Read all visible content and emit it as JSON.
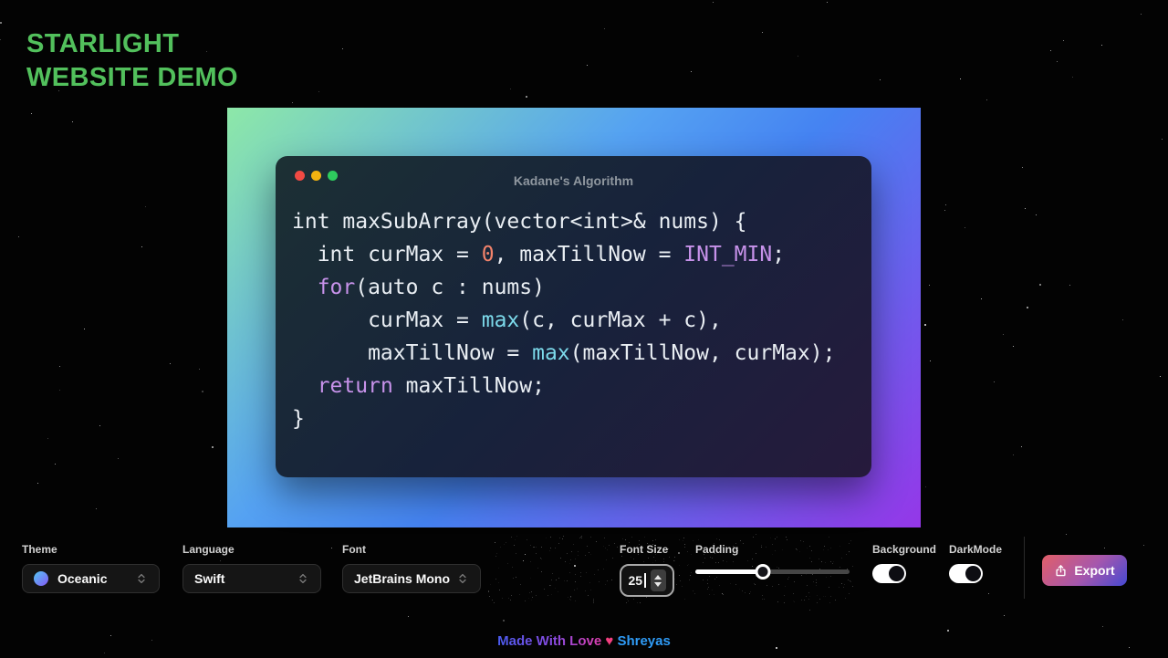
{
  "page": {
    "title_line1": "STARLIGHT",
    "title_line2": "WEBSITE DEMO",
    "title_color": "#52c05c"
  },
  "hero": {
    "gradient_colors": [
      "#8de8a8",
      "#4583f2",
      "#9537e8"
    ]
  },
  "window": {
    "title": "Kadane's Algorithm",
    "traffic_light_colors": [
      "#f04a43",
      "#f2b310",
      "#2ecc5e"
    ],
    "token_colors": {
      "fg": "#e9eef3",
      "kw": "#c792ea",
      "num": "#f2836b",
      "fn": "#7cd9ea"
    },
    "code_lines": [
      [
        {
          "t": "int maxSubArray(vector<int>& nums) {",
          "c": "fg"
        }
      ],
      [
        {
          "t": "  int curMax = ",
          "c": "fg"
        },
        {
          "t": "0",
          "c": "num"
        },
        {
          "t": ", maxTillNow = ",
          "c": "fg"
        },
        {
          "t": "INT_MIN",
          "c": "kw"
        },
        {
          "t": ";",
          "c": "fg"
        }
      ],
      [
        {
          "t": "  ",
          "c": "fg"
        },
        {
          "t": "for",
          "c": "kw"
        },
        {
          "t": "(auto c : nums)",
          "c": "fg"
        }
      ],
      [
        {
          "t": "      curMax = ",
          "c": "fg"
        },
        {
          "t": "max",
          "c": "fn"
        },
        {
          "t": "(c, curMax + c),",
          "c": "fg"
        }
      ],
      [
        {
          "t": "      maxTillNow = ",
          "c": "fg"
        },
        {
          "t": "max",
          "c": "fn"
        },
        {
          "t": "(maxTillNow, curMax);",
          "c": "fg"
        }
      ],
      [
        {
          "t": "  ",
          "c": "fg"
        },
        {
          "t": "return",
          "c": "kw"
        },
        {
          "t": " maxTillNow;",
          "c": "fg"
        }
      ],
      [
        {
          "t": "}",
          "c": "fg"
        }
      ]
    ]
  },
  "toolbar": {
    "theme": {
      "label": "Theme",
      "value": "Oceanic",
      "swatch_icon": "gradient-circle",
      "chevron_icon": "chevron-up-down"
    },
    "language": {
      "label": "Language",
      "value": "Swift",
      "chevron_icon": "chevron-up-down"
    },
    "font": {
      "label": "Font",
      "value": "JetBrains Mono",
      "chevron_icon": "chevron-up-down"
    },
    "font_size": {
      "label": "Font Size",
      "value": "25",
      "stepper_icon": "stepper-arrows"
    },
    "padding": {
      "label": "Padding",
      "percent": 44
    },
    "background": {
      "label": "Background",
      "on": true
    },
    "darkmode": {
      "label": "DarkMode",
      "on": true
    },
    "export": {
      "label": "Export",
      "icon": "share-up-arrow",
      "gradient_colors": [
        "#e25f68",
        "#4549d2"
      ]
    }
  },
  "footer": {
    "made_text": "Made With Love",
    "heart": "♥",
    "author": "Shreyas"
  }
}
